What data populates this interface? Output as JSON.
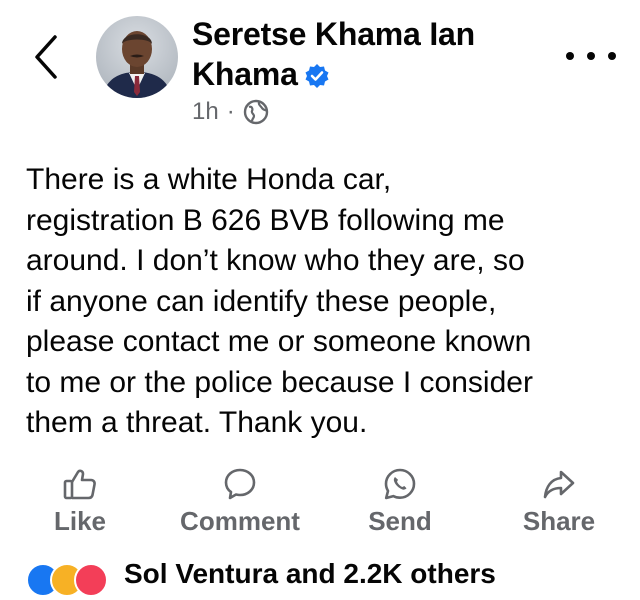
{
  "post": {
    "author": "Seretse Khama Ian Khama",
    "time": "1h",
    "separator": "·",
    "audience_icon": "globe-icon",
    "text": "There is a white Honda car,\nregistration B 626 BVB following me\naround. I don’t know who they are, so\nif anyone can identify these people,\nplease contact me or someone known\nto me or the police because I consider\nthem a threat. Thank you."
  },
  "actions": [
    {
      "label": "Like",
      "icon": "thumbs-up-icon"
    },
    {
      "label": "Comment",
      "icon": "comment-icon"
    },
    {
      "label": "Send",
      "icon": "whatsapp-icon"
    },
    {
      "label": "Share",
      "icon": "share-icon"
    }
  ],
  "reactions": {
    "text": "Sol Ventura and 2.2K others"
  },
  "colors": {
    "text": "#050505",
    "secondary": "#65676b",
    "verified": "#1877f2",
    "like": "#1877f2",
    "love": "#f33e58",
    "care": "#f7b125"
  }
}
